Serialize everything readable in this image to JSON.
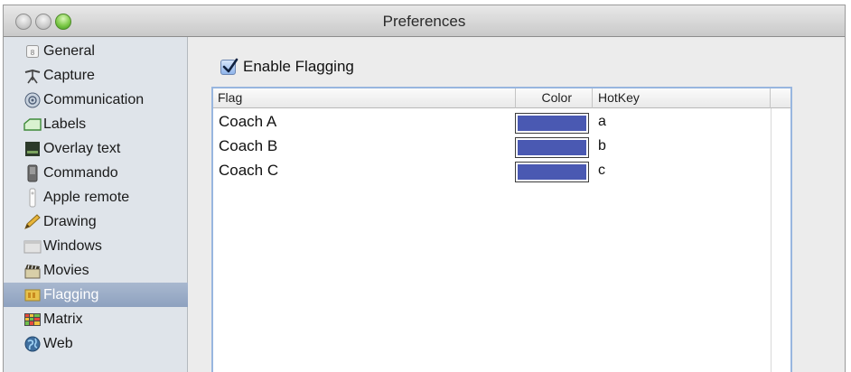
{
  "window": {
    "title": "Preferences"
  },
  "sidebar": {
    "items": [
      {
        "label": "General",
        "icon": "general-icon",
        "selected": false
      },
      {
        "label": "Capture",
        "icon": "capture-icon",
        "selected": false
      },
      {
        "label": "Communication",
        "icon": "communication-icon",
        "selected": false
      },
      {
        "label": "Labels",
        "icon": "labels-icon",
        "selected": false
      },
      {
        "label": "Overlay text",
        "icon": "overlay-text-icon",
        "selected": false
      },
      {
        "label": "Commando",
        "icon": "commando-icon",
        "selected": false
      },
      {
        "label": "Apple remote",
        "icon": "apple-remote-icon",
        "selected": false
      },
      {
        "label": "Drawing",
        "icon": "drawing-icon",
        "selected": false
      },
      {
        "label": "Windows",
        "icon": "windows-icon",
        "selected": false
      },
      {
        "label": "Movies",
        "icon": "movies-icon",
        "selected": false
      },
      {
        "label": "Flagging",
        "icon": "flagging-icon",
        "selected": true
      },
      {
        "label": "Matrix",
        "icon": "matrix-icon",
        "selected": false
      },
      {
        "label": "Web",
        "icon": "web-icon",
        "selected": false
      }
    ]
  },
  "main": {
    "enable_flagging": {
      "label": "Enable Flagging",
      "checked": true
    },
    "table": {
      "columns": [
        "Flag",
        "Color",
        "HotKey"
      ],
      "rows": [
        {
          "flag": "Coach A",
          "color": "#4a59b2",
          "hotkey": "a"
        },
        {
          "flag": "Coach B",
          "color": "#4a59b2",
          "hotkey": "b"
        },
        {
          "flag": "Coach C",
          "color": "#4a59b2",
          "hotkey": "c"
        }
      ]
    }
  }
}
